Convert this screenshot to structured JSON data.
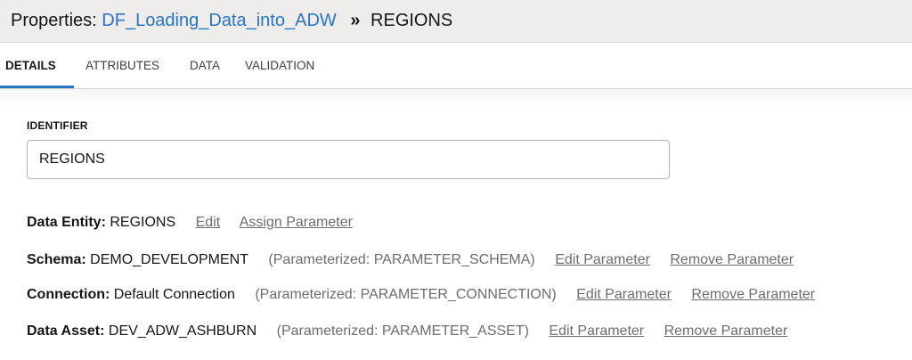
{
  "header": {
    "prefix": "Properties:",
    "link": "DF_Loading_Data_into_ADW",
    "separator": "»",
    "current": "REGIONS"
  },
  "tabs": [
    {
      "label": "DETAILS",
      "active": true
    },
    {
      "label": "ATTRIBUTES",
      "active": false
    },
    {
      "label": "DATA",
      "active": false
    },
    {
      "label": "VALIDATION",
      "active": false
    }
  ],
  "identifier": {
    "label": "IDENTIFIER",
    "value": "REGIONS"
  },
  "properties": [
    {
      "key": "Data Entity:",
      "value": "REGIONS",
      "param": "",
      "actions": [
        "Edit",
        "Assign Parameter"
      ]
    },
    {
      "key": "Schema:",
      "value": "DEMO_DEVELOPMENT",
      "param": "(Parameterized: PARAMETER_SCHEMA)",
      "actions": [
        "Edit Parameter",
        "Remove Parameter"
      ]
    },
    {
      "key": "Connection:",
      "value": "Default Connection",
      "param": "(Parameterized: PARAMETER_CONNECTION)",
      "actions": [
        "Edit Parameter",
        "Remove Parameter"
      ]
    },
    {
      "key": "Data Asset:",
      "value": "DEV_ADW_ASHBURN",
      "param": "(Parameterized: PARAMETER_ASSET)",
      "actions": [
        "Edit Parameter",
        "Remove Parameter"
      ]
    }
  ],
  "colors": {
    "link": "#2b74c0",
    "header_bg": "#eeedec",
    "muted_text": "#6f6c6a"
  }
}
